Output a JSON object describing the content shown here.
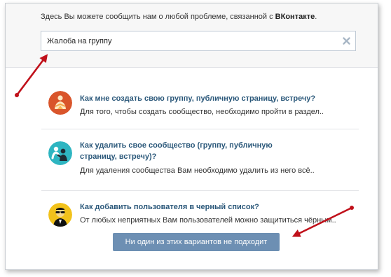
{
  "dialog": {
    "intro_text": "Здесь Вы можете сообщить нам о любой проблеме, связанной с ",
    "brand": "ВКонтакте",
    "intro_end": "."
  },
  "search": {
    "value": "Жалоба на группу",
    "clear_icon": "close-icon"
  },
  "results": [
    {
      "icon": "group-people-icon",
      "title": "Как мне создать свою группу, публичную страницу, встречу?",
      "snippet": "Для того, чтобы создать сообщество, необходимо пройти в раздел.."
    },
    {
      "icon": "delete-community-icon",
      "title": "Как удалить свое сообщество (группу, публичную страницу, встречу)?",
      "snippet": "Для удаления сообщества Вам необходимо удалить из него всё.."
    },
    {
      "icon": "blacklist-agent-icon",
      "title": "Как добавить пользователя в черный список?",
      "snippet": "От любых неприятных Вам пользователей можно защититься чёрным.."
    }
  ],
  "actions": {
    "none_fits_label": "Ни один из этих вариантов не подходит"
  },
  "colors": {
    "link": "#2b587a",
    "button": "#6d8fb3",
    "annotation_arrow": "#c0101a"
  }
}
